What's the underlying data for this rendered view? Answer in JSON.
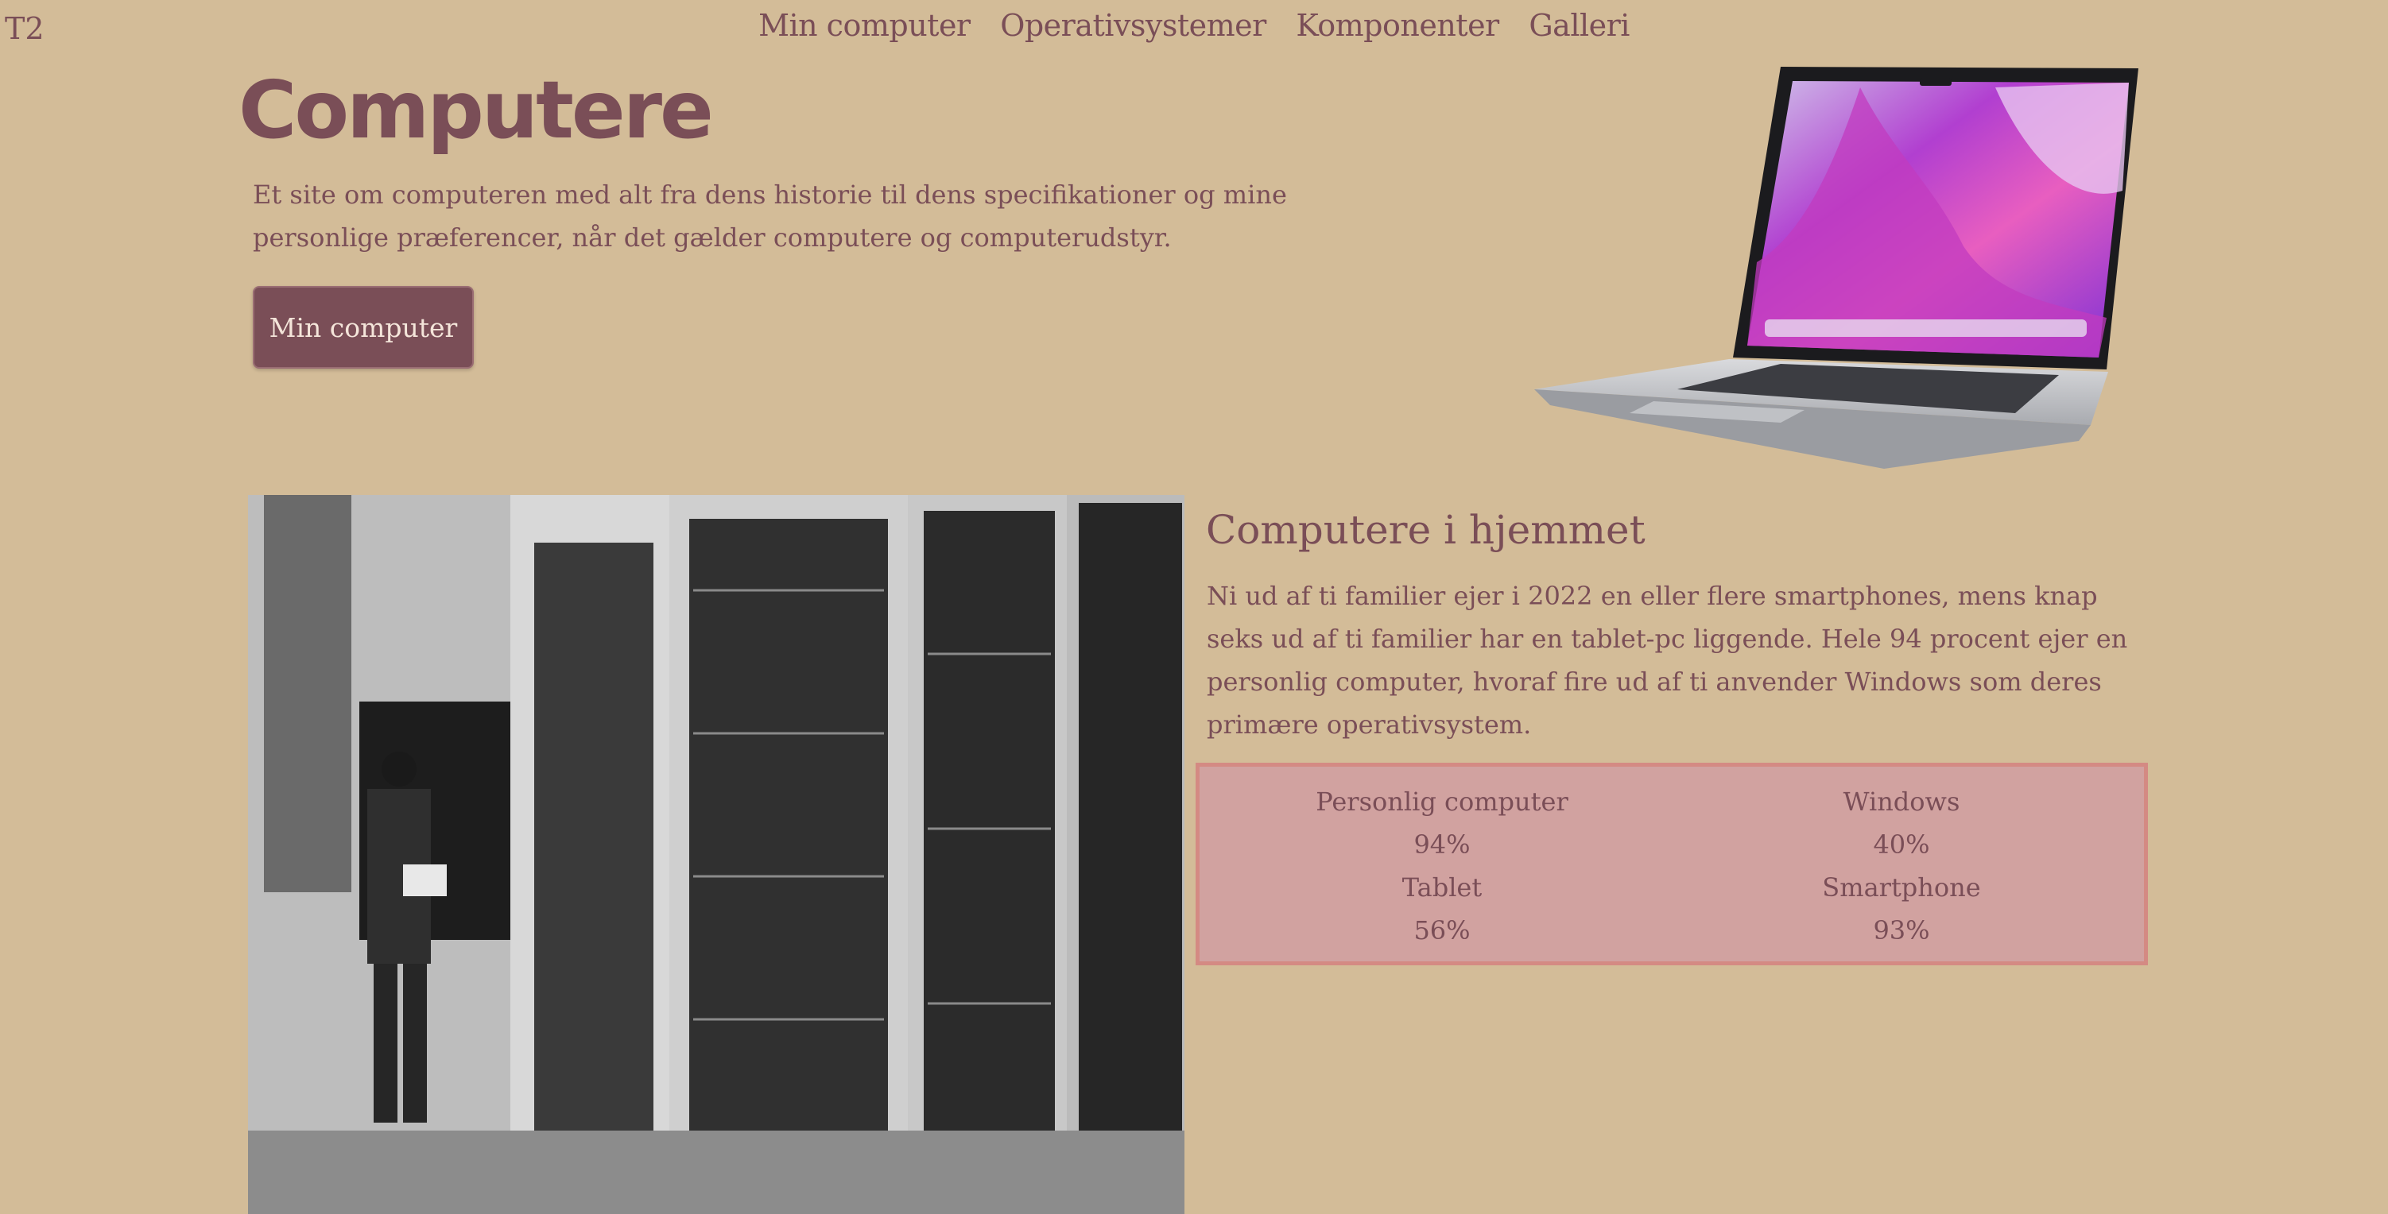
{
  "header": {
    "logo": "T2",
    "nav": [
      "Min computer",
      "Operativsystemer",
      "Komponenter",
      "Galleri"
    ]
  },
  "hero": {
    "title": "Computere",
    "intro": "Et site om computeren med alt fra dens historie til dens specifikationer og mine personlige præferencer, når det gælder computere og computerudstyr.",
    "button_label": "Min computer"
  },
  "section": {
    "title": "Computere i hjemmet",
    "text": "Ni ud af ti familier ejer i 2022 en eller flere smartphones, mens knap seks ud af ti familier har en tablet-pc liggende. Hele 94 procent ejer en personlig computer, hvoraf fire ud af ti anvender Windows som deres primære operativsystem."
  },
  "stats": [
    {
      "label": "Personlig computer",
      "value": "94%"
    },
    {
      "label": "Windows",
      "value": "40%"
    },
    {
      "label": "Tablet",
      "value": "56%"
    },
    {
      "label": "Smartphone",
      "value": "93%"
    }
  ],
  "colors": {
    "background": "#d3bc98",
    "text": "#7a4e57",
    "button": "#7a4e57",
    "stats_box": "#d1a2a0",
    "stats_border": "#d48a83"
  }
}
